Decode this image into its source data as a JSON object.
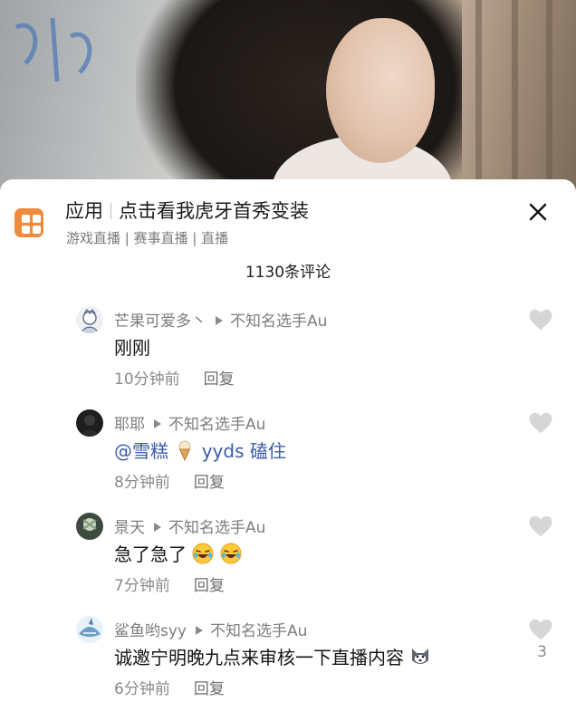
{
  "app_banner": {
    "name": "应用",
    "title": "点击看我虎牙首秀变装",
    "subtitle": "游戏直播 | 赛事直播 | 直播"
  },
  "comments_header": {
    "count_label": "1130条评论"
  },
  "comments": [
    {
      "user": "芒果可爱多丶",
      "reply_to": "不知名选手Au",
      "text": "刚刚",
      "time": "10分钟前",
      "reply_label": "回复",
      "likes": ""
    },
    {
      "user": "耶耶",
      "reply_to": "不知名选手Au",
      "mention": "@雪糕",
      "text": "yyds 磕住",
      "time": "8分钟前",
      "reply_label": "回复",
      "likes": ""
    },
    {
      "user": "景天",
      "reply_to": "不知名选手Au",
      "text": "急了急了",
      "time": "7分钟前",
      "reply_label": "回复",
      "likes": ""
    },
    {
      "user": "鲨鱼哟syy",
      "reply_to": "不知名选手Au",
      "text": "诚邀宁明晚九点来审核一下直播内容",
      "time": "6分钟前",
      "reply_label": "回复",
      "likes": "3"
    }
  ],
  "colors": {
    "accent_orange": "#f08a3c",
    "mention_blue": "#3b5ba8",
    "like_grey": "#d6d6d6"
  }
}
